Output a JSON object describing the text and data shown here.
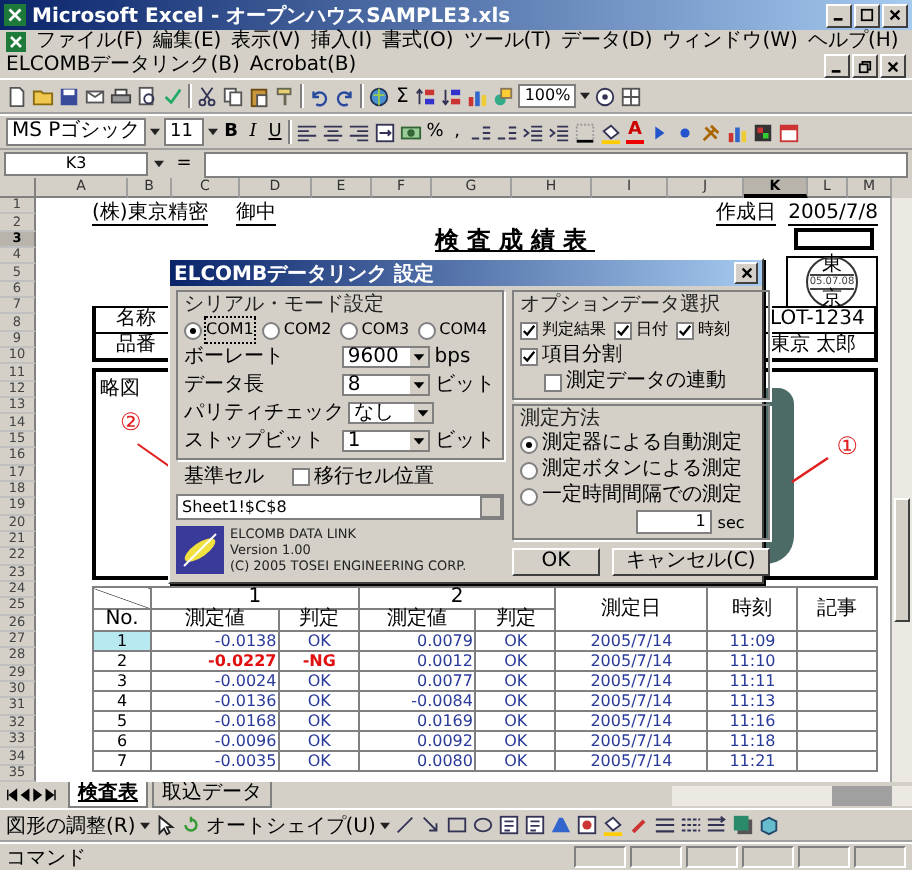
{
  "window": {
    "title": "Microsoft Excel - オープンハウスSAMPLE3.xls"
  },
  "menu": [
    "ファイル(F)",
    "編集(E)",
    "表示(V)",
    "挿入(I)",
    "書式(O)",
    "ツール(T)",
    "データ(D)",
    "ウィンドウ(W)",
    "ヘルプ(H)",
    "ELCOMBデータリンク(B)",
    "Acrobat(B)"
  ],
  "standard_toolbar": {
    "autosum": "Σ",
    "zoom": "100%"
  },
  "formatting_toolbar": {
    "font": "MS Pゴシック",
    "size": "11",
    "bold": "B",
    "italic": "I",
    "underline": "U",
    "percent": "%",
    "comma": ",",
    "font_color": "A"
  },
  "formula_bar": {
    "name_box": "K3",
    "equals": "="
  },
  "columns": [
    {
      "label": "A",
      "selected": false
    },
    {
      "label": "B",
      "selected": false
    },
    {
      "label": "C",
      "selected": false
    },
    {
      "label": "D",
      "selected": false
    },
    {
      "label": "E",
      "selected": false
    },
    {
      "label": "F",
      "selected": false
    },
    {
      "label": "G",
      "selected": false
    },
    {
      "label": "H",
      "selected": false
    },
    {
      "label": "I",
      "selected": false
    },
    {
      "label": "J",
      "selected": false
    },
    {
      "label": "K",
      "selected": true
    },
    {
      "label": "L",
      "selected": false
    },
    {
      "label": "M",
      "selected": false
    }
  ],
  "rows": [
    {
      "label": "1",
      "selected": false
    },
    {
      "label": "2",
      "selected": false
    },
    {
      "label": "3",
      "selected": true
    },
    {
      "label": "4",
      "selected": false
    },
    {
      "label": "5",
      "selected": false
    },
    {
      "label": "6",
      "selected": false
    },
    {
      "label": "7",
      "selected": false
    },
    {
      "label": "8",
      "selected": false
    },
    {
      "label": "9",
      "selected": false
    },
    {
      "label": "10",
      "selected": false
    },
    {
      "label": "11",
      "selected": false
    },
    {
      "label": "12",
      "selected": false
    },
    {
      "label": "13",
      "selected": false
    },
    {
      "label": "14",
      "selected": false
    },
    {
      "label": "15",
      "selected": false
    },
    {
      "label": "16",
      "selected": false
    },
    {
      "label": "17",
      "selected": false
    },
    {
      "label": "18",
      "selected": false
    },
    {
      "label": "19",
      "selected": false
    },
    {
      "label": "20",
      "selected": false
    },
    {
      "label": "21",
      "selected": false
    },
    {
      "label": "22",
      "selected": false
    },
    {
      "label": "23",
      "selected": false
    },
    {
      "label": "24",
      "selected": false
    },
    {
      "label": "25",
      "selected": false
    },
    {
      "label": "26",
      "selected": false
    },
    {
      "label": "27",
      "selected": false
    },
    {
      "label": "28",
      "selected": false
    },
    {
      "label": "29",
      "selected": false
    },
    {
      "label": "30",
      "selected": false
    },
    {
      "label": "31",
      "selected": false
    },
    {
      "label": "32",
      "selected": false
    },
    {
      "label": "33",
      "selected": false
    },
    {
      "label": "34",
      "selected": false
    },
    {
      "label": "35",
      "selected": false
    }
  ],
  "sheet": {
    "addressee": "(株)東京精密",
    "honorific": "御中",
    "created_label": "作成日",
    "created_date": "2005/7/8",
    "title": "検査成績表",
    "stamp": {
      "top": "東",
      "date": "05.07.08",
      "bottom": "京"
    },
    "info_rows": [
      {
        "label": "名称",
        "value": "LOT-1234"
      },
      {
        "label": "品番",
        "value": "東京 太郎"
      }
    ],
    "figure": {
      "label": "略図",
      "callout_left": "②",
      "callout_right": "①"
    },
    "table": {
      "corner": "No.",
      "groups": [
        "1",
        "2"
      ],
      "headers": [
        "測定日",
        "時刻",
        "記事"
      ],
      "sub_headers": [
        "測定値",
        "判定",
        "測定値",
        "判定"
      ],
      "rows": [
        {
          "no": "1",
          "selected": true,
          "m": [
            {
              "value": "-0.0138",
              "verdict": "OK",
              "ng": false
            },
            {
              "value": "0.0079",
              "verdict": "OK",
              "ng": false
            }
          ],
          "date": "2005/7/14",
          "time": "11:09"
        },
        {
          "no": "2",
          "selected": false,
          "m": [
            {
              "value": "-0.0227",
              "verdict": "-NG",
              "ng": true
            },
            {
              "value": "0.0012",
              "verdict": "OK",
              "ng": false
            }
          ],
          "date": "2005/7/14",
          "time": "11:10"
        },
        {
          "no": "3",
          "selected": false,
          "m": [
            {
              "value": "-0.0024",
              "verdict": "OK",
              "ng": false
            },
            {
              "value": "0.0077",
              "verdict": "OK",
              "ng": false
            }
          ],
          "date": "2005/7/14",
          "time": "11:11"
        },
        {
          "no": "4",
          "selected": false,
          "m": [
            {
              "value": "-0.0136",
              "verdict": "OK",
              "ng": false
            },
            {
              "value": "-0.0084",
              "verdict": "OK",
              "ng": false
            }
          ],
          "date": "2005/7/14",
          "time": "11:13"
        },
        {
          "no": "5",
          "selected": false,
          "m": [
            {
              "value": "-0.0168",
              "verdict": "OK",
              "ng": false
            },
            {
              "value": "0.0169",
              "verdict": "OK",
              "ng": false
            }
          ],
          "date": "2005/7/14",
          "time": "11:16"
        },
        {
          "no": "6",
          "selected": false,
          "m": [
            {
              "value": "-0.0096",
              "verdict": "OK",
              "ng": false
            },
            {
              "value": "0.0092",
              "verdict": "OK",
              "ng": false
            }
          ],
          "date": "2005/7/14",
          "time": "11:18"
        },
        {
          "no": "7",
          "selected": false,
          "m": [
            {
              "value": "-0.0035",
              "verdict": "OK",
              "ng": false
            },
            {
              "value": "0.0080",
              "verdict": "OK",
              "ng": false
            }
          ],
          "date": "2005/7/14",
          "time": "11:21"
        }
      ]
    }
  },
  "dialog": {
    "title": "ELCOMBデータリンク 設定",
    "serial": {
      "legend": "シリアル・モード設定",
      "ports": [
        {
          "label": "COM1",
          "selected": true
        },
        {
          "label": "COM2",
          "selected": false
        },
        {
          "label": "COM3",
          "selected": false
        },
        {
          "label": "COM4",
          "selected": false
        }
      ],
      "fields": [
        {
          "label": "ボーレート",
          "value": "9600",
          "unit": "bps"
        },
        {
          "label": "データ長",
          "value": "8",
          "unit": "ビット"
        },
        {
          "label": "パリティチェック",
          "value": "なし"
        },
        {
          "label": "ストップビット",
          "value": "1",
          "unit": "ビット"
        }
      ]
    },
    "base_cell": {
      "label": "基準セル",
      "checkbox_label": "移行セル位置",
      "checked": false,
      "value": "Sheet1!$C$8"
    },
    "about": {
      "product": "ELCOMB DATA LINK",
      "version": "Version 1.00",
      "copyright": "(C) 2005 TOSEI ENGINEERING CORP."
    },
    "options": {
      "legend": "オプションデータ選択",
      "items": [
        {
          "label": "判定結果",
          "checked": true
        },
        {
          "label": "日付",
          "checked": true
        },
        {
          "label": "時刻",
          "checked": true
        }
      ],
      "split": {
        "label": "項目分割",
        "checked": true
      },
      "link": {
        "label": "測定データの連動",
        "checked": false
      }
    },
    "method": {
      "legend": "測定方法",
      "options": [
        {
          "label": "測定器による自動測定",
          "selected": true
        },
        {
          "label": "測定ボタンによる測定",
          "selected": false
        },
        {
          "label": "一定時間間隔での測定",
          "selected": false
        }
      ],
      "interval": {
        "value": "1",
        "unit": "sec"
      }
    },
    "buttons": [
      "OK",
      "キャンセル(C)"
    ]
  },
  "sheet_tabs": [
    {
      "label": "検査表",
      "selected": true
    },
    {
      "label": "取込データ",
      "selected": false
    }
  ],
  "drawing_toolbar": {
    "arrange": "図形の調整(R)",
    "autoshape": "オートシェイプ(U)"
  },
  "status_bar": {
    "text": "コマンド"
  }
}
